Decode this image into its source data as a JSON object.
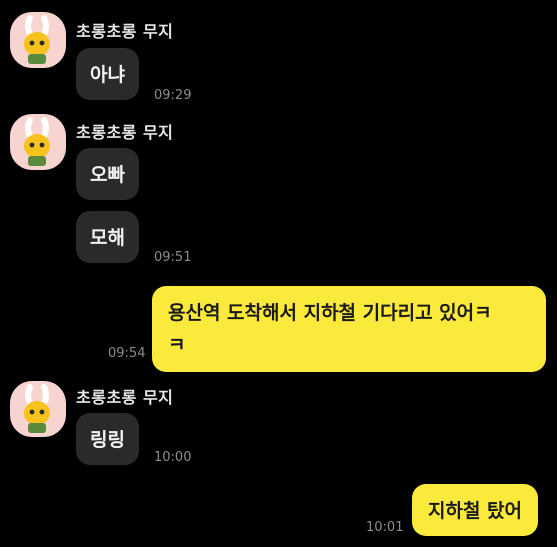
{
  "chat": {
    "messages": [
      {
        "sender": "초롱초롱 무지",
        "text": "아냐",
        "time": "09:29"
      },
      {
        "sender": "초롱초롱 무지",
        "text": "오빠",
        "time": ""
      },
      {
        "sender": "",
        "text": "모해",
        "time": "09:51"
      },
      {
        "sender": "me",
        "text": "용산역 도착해서 지하철 기다리고 있어ㅋ\nㅋ",
        "time": "09:54"
      },
      {
        "sender": "초롱초롱 무지",
        "text": "링링",
        "time": "10:00"
      },
      {
        "sender": "me",
        "text": "지하철 탔어",
        "time": "10:01"
      }
    ]
  },
  "colors": {
    "background": "#000000",
    "incoming_bubble": "#2a2a2a",
    "outgoing_bubble": "#fbea3c",
    "avatar_bg": "#f7d4cf"
  },
  "icons": {
    "avatar": "muzi-rabbit-avatar-icon"
  }
}
